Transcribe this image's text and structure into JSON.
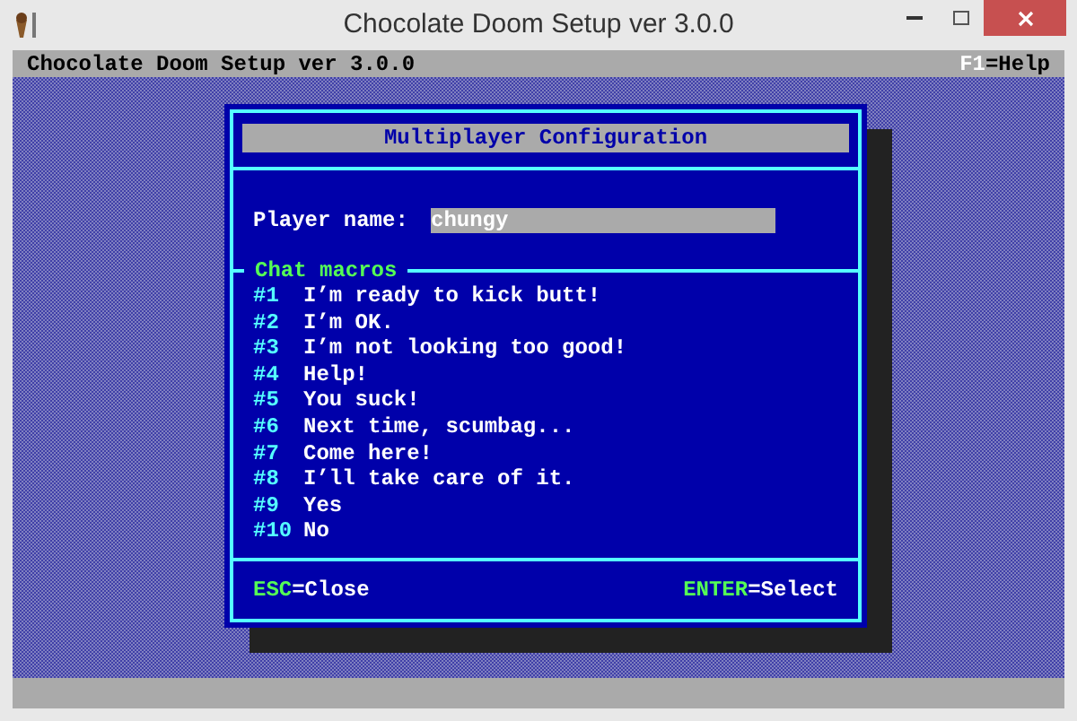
{
  "window": {
    "title": "Chocolate Doom Setup ver 3.0.0"
  },
  "header": {
    "title": "Chocolate Doom Setup ver 3.0.0",
    "help_key": "F1",
    "help_label": "=Help"
  },
  "dialog": {
    "title": "Multiplayer Configuration",
    "player_name": {
      "label": "Player name:",
      "value": "chungy"
    },
    "section_title": "Chat macros",
    "macros": [
      {
        "number": "#1",
        "text": "I’m ready to kick butt!"
      },
      {
        "number": "#2",
        "text": "I’m OK."
      },
      {
        "number": "#3",
        "text": "I’m not looking too good!"
      },
      {
        "number": "#4",
        "text": "Help!"
      },
      {
        "number": "#5",
        "text": "You suck!"
      },
      {
        "number": "#6",
        "text": "Next time, scumbag..."
      },
      {
        "number": "#7",
        "text": "Come here!"
      },
      {
        "number": "#8",
        "text": "I’ll take care of it."
      },
      {
        "number": "#9",
        "text": "Yes"
      },
      {
        "number": "#10",
        "text": "No"
      }
    ],
    "actions": [
      {
        "key": "ESC",
        "label": "=Close"
      },
      {
        "key": "ENTER",
        "label": "=Select"
      }
    ]
  }
}
